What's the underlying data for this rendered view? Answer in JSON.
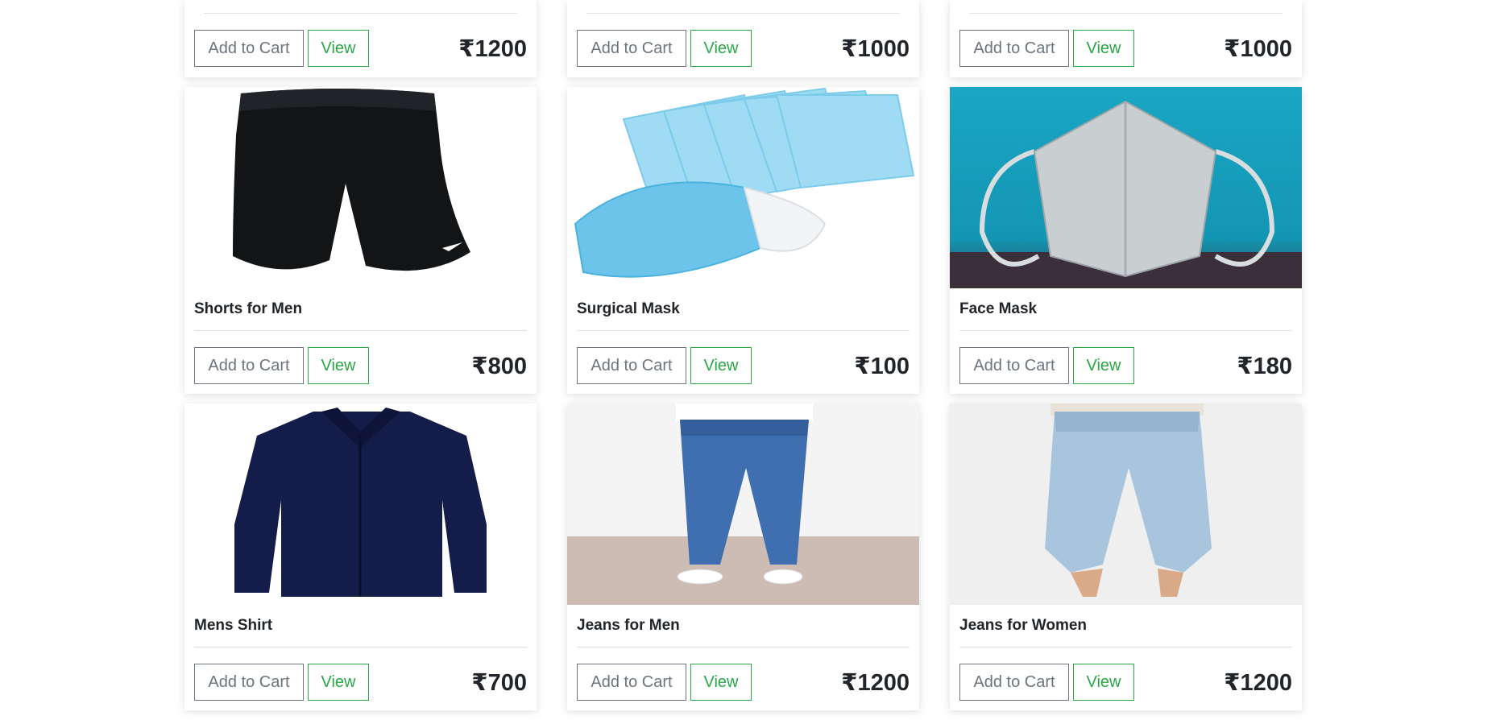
{
  "buttons": {
    "add_to_cart": "Add to Cart",
    "view": "View"
  },
  "top_row": [
    {
      "price": "₹1200"
    },
    {
      "price": "₹1000"
    },
    {
      "price": "₹1000"
    }
  ],
  "products": [
    {
      "name": "Shorts for Men",
      "price": "₹800",
      "image_icon": "shorts-image"
    },
    {
      "name": "Surgical Mask",
      "price": "₹100",
      "image_icon": "surgical-mask-image"
    },
    {
      "name": "Face Mask",
      "price": "₹180",
      "image_icon": "face-mask-image"
    },
    {
      "name": "Mens Shirt",
      "price": "₹700",
      "image_icon": "shirt-image"
    },
    {
      "name": "Jeans for Men",
      "price": "₹1200",
      "image_icon": "mens-jeans-image"
    },
    {
      "name": "Jeans for Women",
      "price": "₹1200",
      "image_icon": "womens-jeans-image"
    }
  ],
  "colors": {
    "view_accent": "#28a745",
    "cart_border": "#6c757d",
    "text": "#212529"
  }
}
